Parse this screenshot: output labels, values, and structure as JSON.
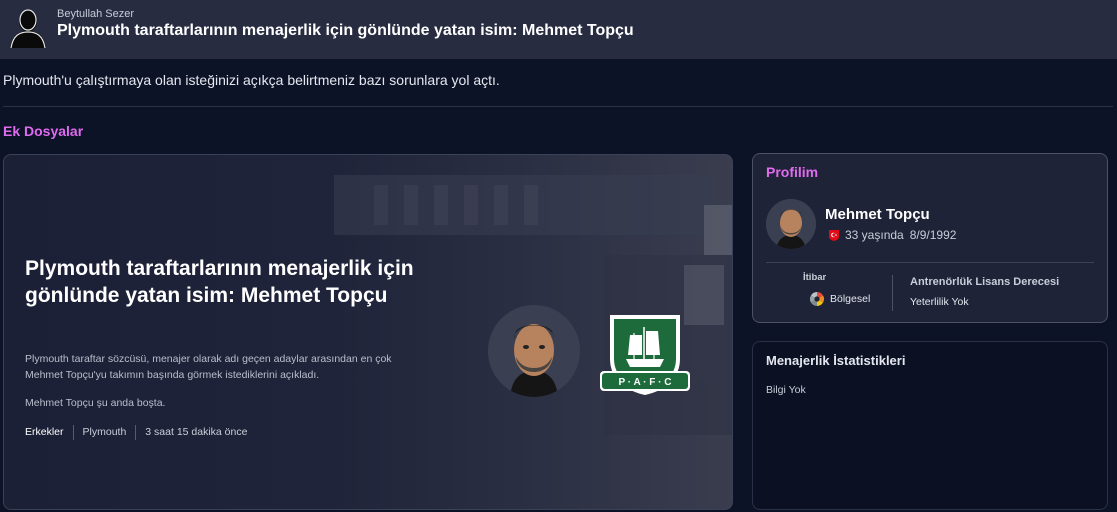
{
  "header": {
    "sender_name": "Beytullah Sezer",
    "title": "Plymouth taraftarlarının menajerlik için gönlünde yatan isim: Mehmet Topçu"
  },
  "message": {
    "body": "Plymouth'u çalıştırmaya olan isteğinizi açıkça belirtmeniz bazı sorunlara yol açtı."
  },
  "attachments": {
    "label": "Ek Dosyalar"
  },
  "news": {
    "title": "Plymouth taraftarlarının menajerlik için gönlünde yatan isim: Mehmet Topçu",
    "description": "Plymouth taraftar sözcüsü, menajer olarak adı geçen adaylar arasından en çok Mehmet Topçu'yu takımın başında görmek istediklerini açıkladı.",
    "status": "Mehmet Topçu şu anda boşta.",
    "tags": [
      "Erkekler",
      "Plymouth",
      "3 saat 15 dakika önce"
    ],
    "crest_text": "P · A · F · C"
  },
  "profile": {
    "label": "Profilim",
    "name": "Mehmet Topçu",
    "age": "33 yaşında",
    "dob": "8/9/1992",
    "reputation_label": "İtibar",
    "reputation_value": "Bölgesel",
    "license_label": "Antrenörlük Lisans Derecesi",
    "license_value": "Yeterlilik Yok"
  },
  "stats": {
    "title": "Menajerlik İstatistikleri",
    "empty": "Bilgi Yok"
  },
  "colors": {
    "accent": "#e06bf0",
    "header_bg": "#272c41",
    "page_bg": "#0d1326",
    "crest_green": "#1d6b3a"
  }
}
